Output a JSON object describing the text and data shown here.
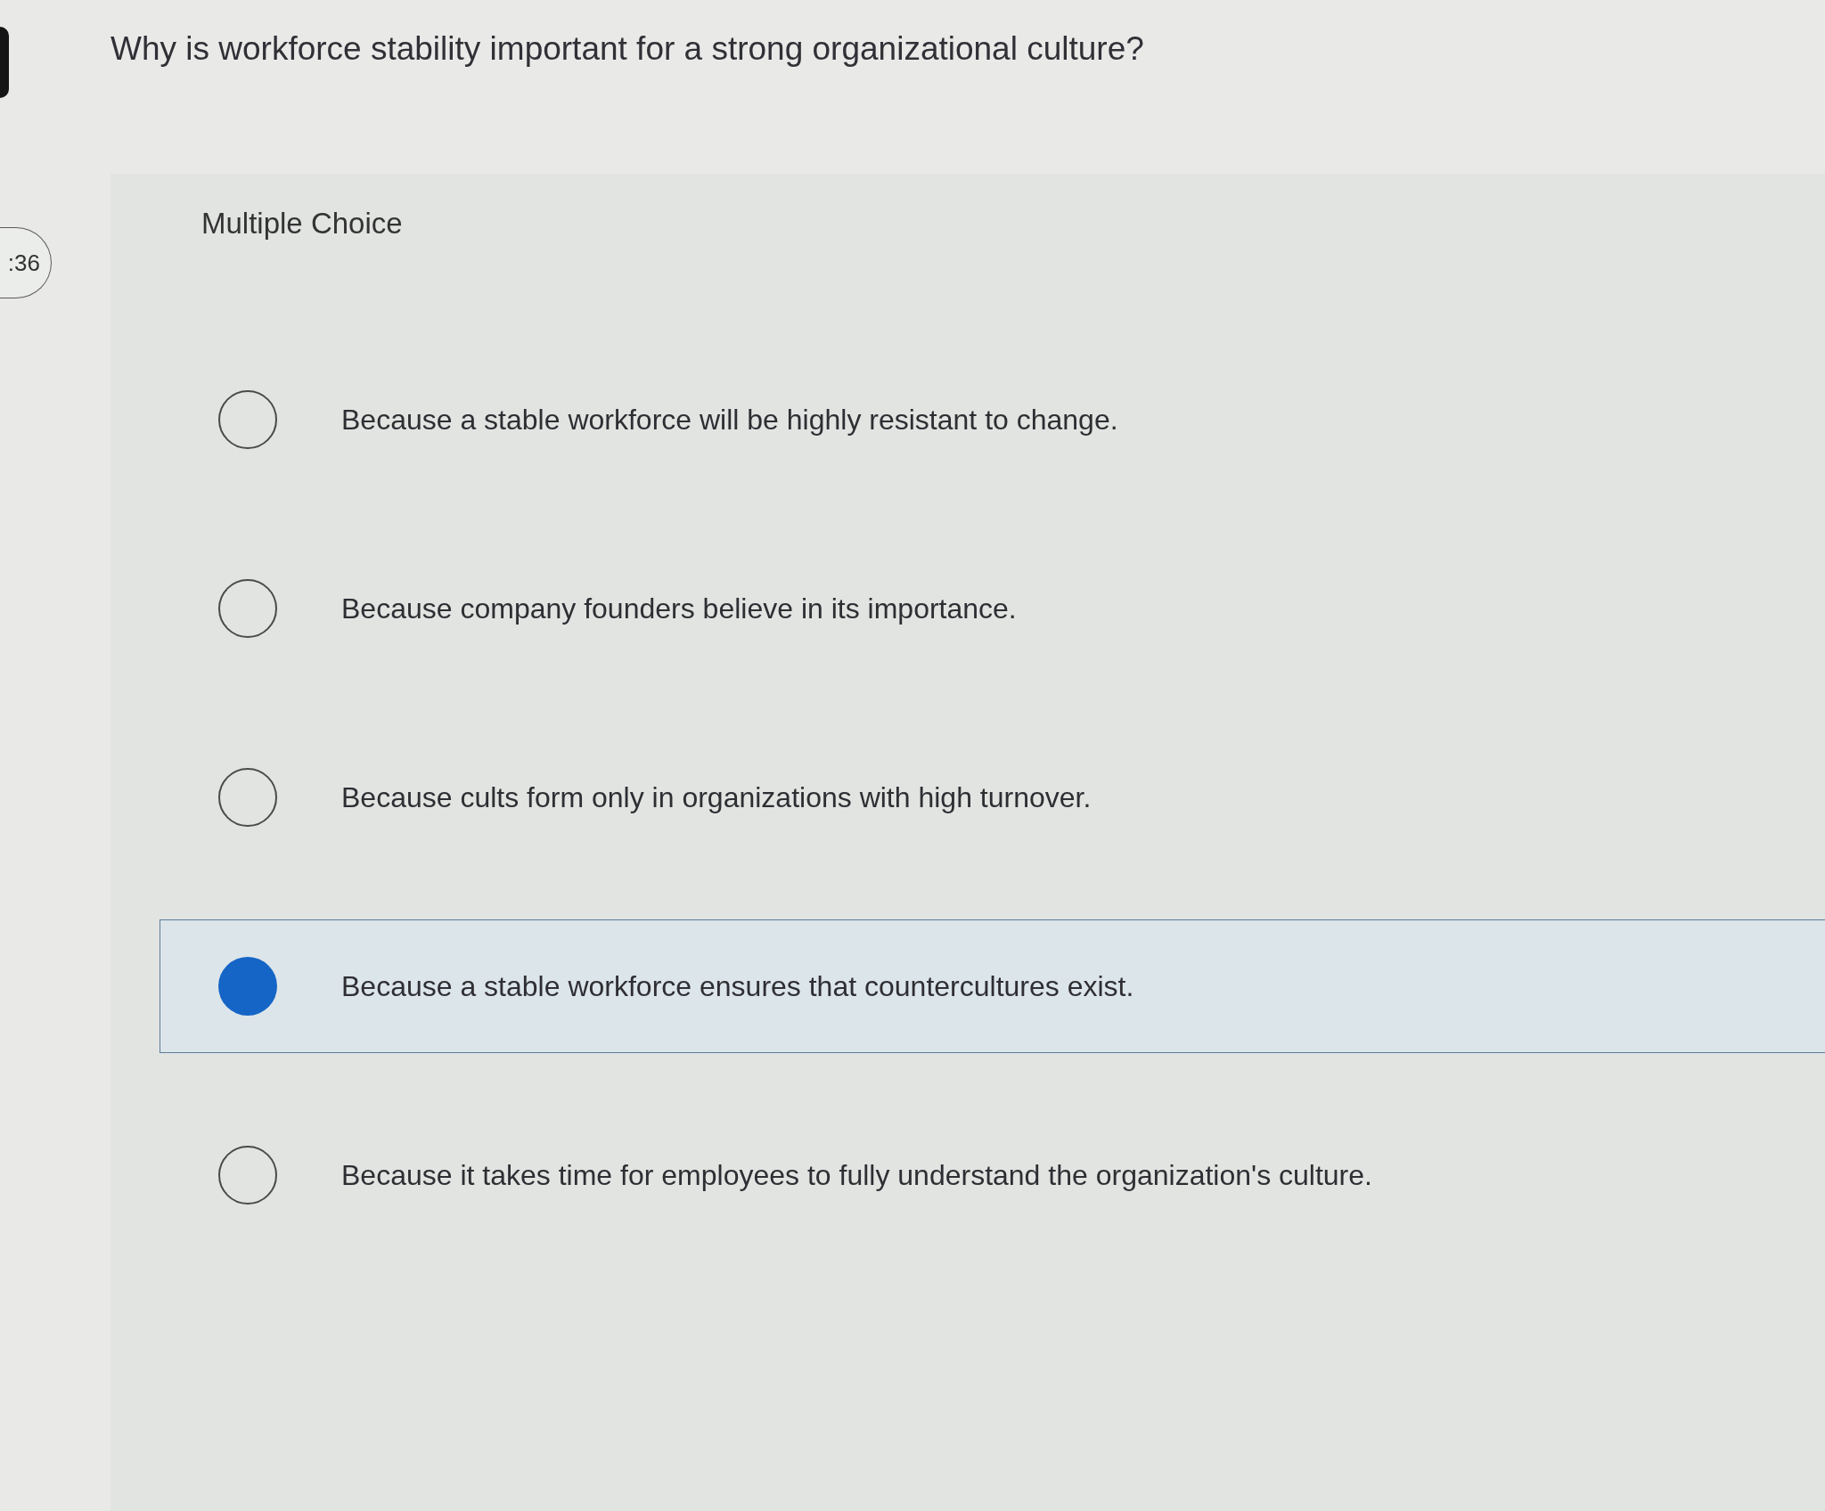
{
  "timer": {
    "text": ":36"
  },
  "question": {
    "text": "Why is workforce stability important for a strong organizational culture?"
  },
  "question_type": "Multiple Choice",
  "options": [
    {
      "label": "Because a stable workforce will be highly resistant to change.",
      "selected": false
    },
    {
      "label": "Because company founders believe in its importance.",
      "selected": false
    },
    {
      "label": "Because cults form only in organizations with high turnover.",
      "selected": false
    },
    {
      "label": "Because a stable workforce ensures that countercultures exist.",
      "selected": true
    },
    {
      "label": "Because it takes time for employees to fully understand the organization's culture.",
      "selected": false
    }
  ]
}
